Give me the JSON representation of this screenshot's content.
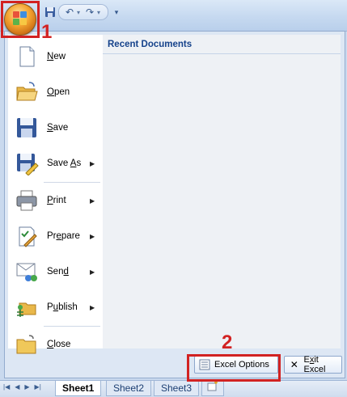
{
  "qat": {
    "icons": [
      "save-icon",
      "undo-icon",
      "redo-icon",
      "customize-dropdown-icon"
    ]
  },
  "menu": {
    "items": [
      {
        "label_pre": "",
        "label_u": "N",
        "label_post": "ew",
        "icon": "new-document-icon",
        "submenu": false
      },
      {
        "label_pre": "",
        "label_u": "O",
        "label_post": "pen",
        "icon": "open-folder-icon",
        "submenu": false
      },
      {
        "label_pre": "",
        "label_u": "S",
        "label_post": "ave",
        "icon": "save-disk-icon",
        "submenu": false
      },
      {
        "label_pre": "Save ",
        "label_u": "A",
        "label_post": "s",
        "icon": "save-as-icon",
        "submenu": true
      },
      {
        "label_pre": "",
        "label_u": "P",
        "label_post": "rint",
        "icon": "printer-icon",
        "submenu": true
      },
      {
        "label_pre": "Pr",
        "label_u": "e",
        "label_post": "pare",
        "icon": "prepare-icon",
        "submenu": true
      },
      {
        "label_pre": "Sen",
        "label_u": "d",
        "label_post": "",
        "icon": "send-icon",
        "submenu": true
      },
      {
        "label_pre": "P",
        "label_u": "u",
        "label_post": "blish",
        "icon": "publish-icon",
        "submenu": true
      },
      {
        "label_pre": "",
        "label_u": "C",
        "label_post": "lose",
        "icon": "close-folder-icon",
        "submenu": false
      }
    ],
    "recent_title": "Recent Documents",
    "options_button": "Excel Options",
    "exit_pre": "E",
    "exit_u": "x",
    "exit_post": "it Excel"
  },
  "annotations": {
    "one": "1",
    "two": "2"
  },
  "sheets": {
    "tabs": [
      "Sheet1",
      "Sheet2",
      "Sheet3"
    ],
    "active": "Sheet1"
  },
  "colors": {
    "highlight": "#d22222",
    "title_blue": "#15428b"
  }
}
